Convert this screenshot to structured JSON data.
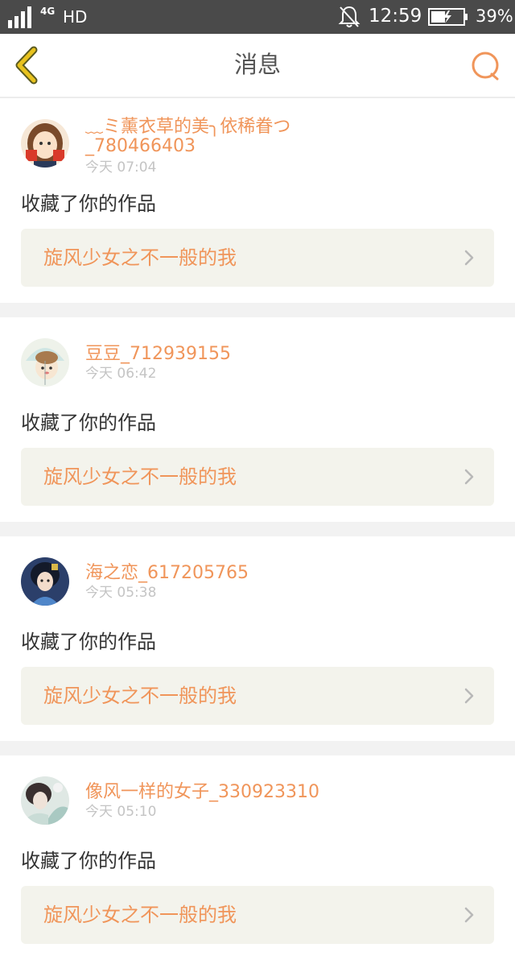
{
  "status_bar": {
    "network": "4G",
    "hd": "HD",
    "time": "12:59",
    "battery": "39%"
  },
  "header": {
    "title": "消息"
  },
  "messages": [
    {
      "name": "﹏ミ薰衣草的美╮依稀眷つ_780466403",
      "time": "今天 07:04",
      "action": "收藏了你的作品",
      "work": "旋风少女之不一般的我"
    },
    {
      "name": "豆豆_712939155",
      "time": "今天 06:42",
      "action": "收藏了你的作品",
      "work": "旋风少女之不一般的我"
    },
    {
      "name": "海之恋_617205765",
      "time": "今天 05:38",
      "action": "收藏了你的作品",
      "work": "旋风少女之不一般的我"
    },
    {
      "name": "像风一样的女子_330923310",
      "time": "今天 05:10",
      "action": "收藏了你的作品",
      "work": "旋风少女之不一般的我"
    }
  ],
  "colors": {
    "accent": "#f0955a",
    "back_arrow": "#e8c21e",
    "muted": "#c4c4c4"
  },
  "icons": {
    "back": "chevron-left-icon",
    "search": "search-icon",
    "row_arrow": "chevron-right-icon"
  }
}
